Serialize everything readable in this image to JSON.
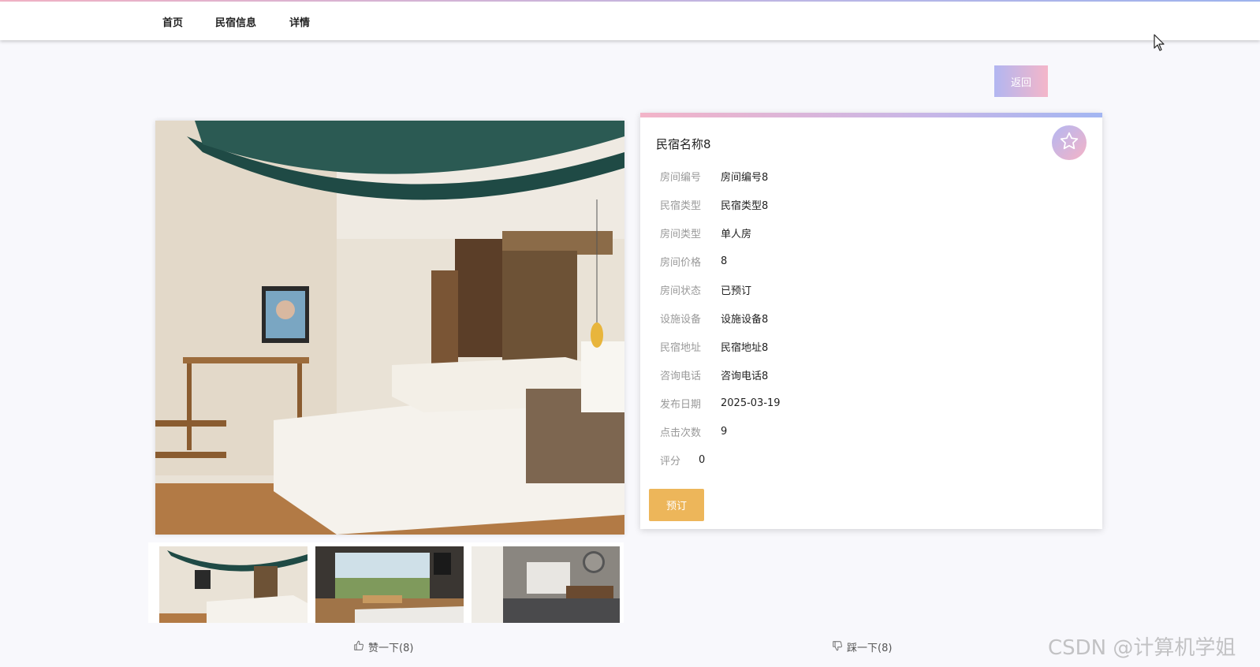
{
  "nav": {
    "items": [
      "首页",
      "民宿信息",
      "详情"
    ]
  },
  "back_button": "返回",
  "detail": {
    "title": "民宿名称8",
    "fields": [
      {
        "label": "房间编号",
        "value": "房间编号8"
      },
      {
        "label": "民宿类型",
        "value": "民宿类型8"
      },
      {
        "label": "房间类型",
        "value": "单人房"
      },
      {
        "label": "房间价格",
        "value": "8"
      },
      {
        "label": "房间状态",
        "value": "已预订"
      },
      {
        "label": "设施设备",
        "value": "设施设备8"
      },
      {
        "label": "民宿地址",
        "value": "民宿地址8"
      },
      {
        "label": "咨询电话",
        "value": "咨询电话8"
      },
      {
        "label": "发布日期",
        "value": "2025-03-19"
      },
      {
        "label": "点击次数",
        "value": "9"
      },
      {
        "label": "评分",
        "value": "0"
      }
    ],
    "book_button": "预订"
  },
  "votes": {
    "like": "赞一下(8)",
    "dislike": "踩一下(8)"
  },
  "watermark": "CSDN @计算机学姐",
  "icons": {
    "favorite": "star-icon",
    "like": "thumbs-up-icon",
    "dislike": "thumbs-down-icon"
  },
  "colors": {
    "accent_pink": "#f4b6c9",
    "accent_blue": "#a3b6f2",
    "book_button": "#edb65a"
  }
}
